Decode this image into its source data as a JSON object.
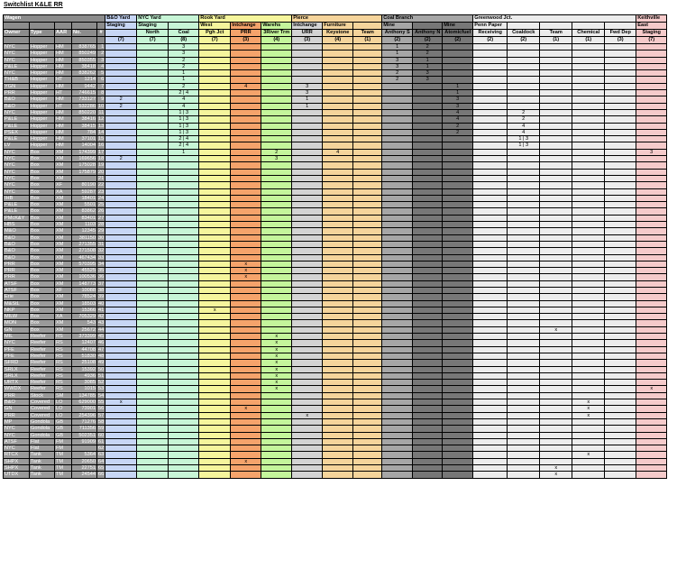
{
  "title": "Switchlist K&LE RR",
  "groups": [
    {
      "label": "Wagen",
      "span": 5,
      "cls": "hdrgrey"
    },
    {
      "label": "B&O Yard",
      "span": 1,
      "cls": "b1"
    },
    {
      "label": "NYC Yard",
      "span": 2,
      "cls": "b2"
    },
    {
      "label": "Rook Yard",
      "span": 3,
      "cls": "b3"
    },
    {
      "label": "Pierce",
      "span": 3,
      "cls": "b7"
    },
    {
      "label": "Coal Branch",
      "span": 3,
      "cls": "b8"
    },
    {
      "label": "Greenwood Jct.",
      "span": 5,
      "cls": "b10"
    },
    {
      "label": "Keithville",
      "span": 1,
      "cls": "b11"
    }
  ],
  "subheaders": [
    "",
    "",
    "",
    "",
    "",
    "Staging",
    "Staging",
    "",
    "West",
    "Intchange",
    "Warehs",
    "Intchange",
    "Furniture",
    "",
    "Mine",
    "",
    "Mine",
    "Penn Paper",
    "",
    "",
    "",
    "",
    "East"
  ],
  "headers": [
    "Owner",
    "Type",
    "AAR",
    "No.",
    "#",
    "",
    "North",
    "Coal",
    "Pgh Jct",
    "PRR",
    "3River Trm",
    "URR",
    "Keystone",
    "Team",
    "Anthony S",
    "Anthony N",
    "Atomicfuel",
    "Receiving",
    "Coaldock",
    "Team",
    "Chemical",
    "Fwd Dep",
    "Staging"
  ],
  "capacities": [
    "",
    "",
    "",
    "",
    "",
    "(7)",
    "(7)",
    "(8)",
    "(7)",
    "(3)",
    "(4)",
    "(3)",
    "(4)",
    "(1)",
    "(2)",
    "(2)",
    "(2)",
    "(2)",
    "(2)",
    "(1)",
    "(1)",
    "(3)",
    "(7)"
  ],
  "colClasses": [
    "b1",
    "b2",
    "b2",
    "b3",
    "b4",
    "b5",
    "b6",
    "b7",
    "b7",
    "b8",
    "b9",
    "b9",
    "b10",
    "b10",
    "b10",
    "b10",
    "b10",
    "b11"
  ],
  "rows": [
    [
      "NYC",
      "Hopper",
      "HM",
      "838765",
      "1",
      "",
      "",
      "3",
      "",
      "",
      "",
      "",
      "",
      "",
      "1",
      "2",
      "",
      "",
      "",
      "",
      "",
      "",
      ""
    ],
    [
      "NYC",
      "Hopper",
      "HM",
      "850249",
      "2",
      "",
      "",
      "3",
      "",
      "",
      "",
      "",
      "",
      "",
      "1",
      "2",
      "",
      "",
      "",
      "",
      "",
      "",
      ""
    ],
    [
      "NYC",
      "Hopper",
      "HM",
      "850355",
      "3",
      "",
      "",
      "2",
      "",
      "",
      "",
      "",
      "",
      "",
      "3",
      "1",
      "",
      "",
      "",
      "",
      "",
      "",
      ""
    ],
    [
      "P&LE",
      "Hopper",
      "HM",
      "38418",
      "4",
      "",
      "",
      "2",
      "",
      "",
      "",
      "",
      "",
      "",
      "3",
      "1",
      "",
      "",
      "",
      "",
      "",
      "",
      ""
    ],
    [
      "NYC",
      "Hopper",
      "HM",
      "838262",
      "5",
      "",
      "",
      "1",
      "",
      "",
      "",
      "",
      "",
      "",
      "2",
      "3",
      "",
      "",
      "",
      "",
      "",
      "",
      ""
    ],
    [
      "TH&B",
      "Hopper",
      "HT",
      "1214",
      "6",
      "",
      "",
      "1",
      "",
      "",
      "",
      "",
      "",
      "",
      "2",
      "3",
      "",
      "",
      "",
      "",
      "",
      "",
      ""
    ],
    [
      "YGN",
      "Hopper",
      "HM",
      "9442",
      "7",
      "",
      "",
      "2",
      "",
      "4",
      "",
      "3",
      "",
      "",
      "",
      "",
      "1",
      "",
      "",
      "",
      "",
      "",
      ""
    ],
    [
      "PRR",
      "Hopper",
      "HT",
      "746615",
      "8",
      "",
      "",
      "2 | 4",
      "",
      "",
      "",
      "3",
      "",
      "",
      "",
      "",
      "1",
      "",
      "",
      "",
      "",
      "",
      ""
    ],
    [
      "B&O",
      "Hopper",
      "HM",
      "733127",
      "9",
      "2",
      "",
      "4",
      "",
      "",
      "",
      "1",
      "",
      "",
      "",
      "",
      "3",
      "",
      "",
      "",
      "",
      "",
      ""
    ],
    [
      "B&O",
      "Hopper",
      "HT",
      "532286",
      "10",
      "2",
      "",
      "4",
      "",
      "",
      "",
      "1",
      "",
      "",
      "",
      "",
      "3",
      "",
      "",
      "",
      "",
      "",
      ""
    ],
    [
      "NYC",
      "Hopper",
      "HM",
      "850220",
      "11",
      "",
      "",
      "1 | 3",
      "",
      "",
      "",
      "",
      "",
      "",
      "",
      "",
      "4",
      "",
      "2",
      "",
      "",
      "",
      ""
    ],
    [
      "P&LE",
      "Hopper",
      "HM",
      "38416",
      "12",
      "",
      "",
      "1 | 3",
      "",
      "",
      "",
      "",
      "",
      "",
      "",
      "",
      "4",
      "",
      "2",
      "",
      "",
      "",
      ""
    ],
    [
      "P&LE",
      "Hopper",
      "HM",
      "38415",
      "13",
      "",
      "",
      "1 | 3",
      "",
      "",
      "",
      "",
      "",
      "",
      "",
      "",
      "2",
      "",
      "4",
      "",
      "",
      "",
      ""
    ],
    [
      "PSEX",
      "Hopper",
      "HM",
      "784",
      "14",
      "",
      "",
      "1 | 3",
      "",
      "",
      "",
      "",
      "",
      "",
      "",
      "",
      "2",
      "",
      "4",
      "",
      "",
      "",
      ""
    ],
    [
      "P&LE",
      "Hopper",
      "HM",
      "37101",
      "15",
      "",
      "",
      "2 | 4",
      "",
      "",
      "",
      "",
      "",
      "",
      "",
      "",
      "",
      "",
      "1 | 3",
      "",
      "",
      "",
      ""
    ],
    [
      "LV",
      "Hopper",
      "HM",
      "14004",
      "16",
      "",
      "",
      "2 | 4",
      "",
      "",
      "",
      "",
      "",
      "",
      "",
      "",
      "",
      "",
      "1 | 3",
      "",
      "",
      "",
      ""
    ],
    [
      "NYC",
      "Box",
      "XM",
      "174399",
      "17",
      "",
      "",
      "1",
      "",
      "",
      "2",
      "",
      "4",
      "",
      "",
      "",
      "",
      "",
      "",
      "",
      "",
      "",
      "3"
    ],
    [
      "NYC",
      "Box",
      "XM",
      "169656",
      "18",
      "2",
      "",
      "",
      "",
      "",
      "3",
      "",
      "",
      "",
      "",
      "",
      "",
      "",
      "",
      "",
      "",
      "",
      ""
    ],
    [
      "NYC",
      "Box",
      "XM",
      "175028",
      "19",
      "",
      "",
      "",
      "",
      "",
      "",
      "",
      "",
      "",
      "",
      "",
      "",
      "",
      "",
      "",
      "",
      "",
      ""
    ],
    [
      "NYC",
      "Box",
      "XM",
      "175879",
      "20",
      "",
      "",
      "",
      "",
      "",
      "",
      "",
      "",
      "",
      "",
      "",
      "",
      "",
      "",
      "",
      "",
      "",
      ""
    ],
    [
      "NYC",
      "Box",
      "XM",
      "",
      "21",
      "",
      "",
      "",
      "",
      "",
      "",
      "",
      "",
      "",
      "",
      "",
      "",
      "",
      "",
      "",
      "",
      "",
      ""
    ],
    [
      "NYC",
      "Box",
      "XF",
      "80190",
      "22",
      "",
      "",
      "",
      "",
      "",
      "",
      "",
      "",
      "",
      "",
      "",
      "",
      "",
      "",
      "",
      "",
      "",
      ""
    ],
    [
      "NYC",
      "Box",
      "XA",
      "59287",
      "23",
      "",
      "",
      "",
      "",
      "",
      "",
      "",
      "",
      "",
      "",
      "",
      "",
      "",
      "",
      "",
      "",
      "",
      ""
    ],
    [
      "IHB",
      "Box",
      "XM",
      "18401",
      "24",
      "",
      "",
      "",
      "",
      "",
      "",
      "",
      "",
      "",
      "",
      "",
      "",
      "",
      "",
      "",
      "",
      "",
      ""
    ],
    [
      "P&LE",
      "Box",
      "XM",
      "5501",
      "25",
      "",
      "",
      "",
      "",
      "",
      "",
      "",
      "",
      "",
      "",
      "",
      "",
      "",
      "",
      "",
      "",
      "",
      ""
    ],
    [
      "P&LE",
      "Box",
      "XM",
      "83862",
      "26",
      "",
      "",
      "",
      "",
      "",
      "",
      "",
      "",
      "",
      "",
      "",
      "",
      "",
      "",
      "",
      "",
      "",
      ""
    ],
    [
      "PMcK&Y",
      "Box",
      "XM",
      "83401",
      "27",
      "",
      "",
      "",
      "",
      "",
      "",
      "",
      "",
      "",
      "",
      "",
      "",
      "",
      "",
      "",
      "",
      "",
      ""
    ],
    [
      "HBS",
      "Box",
      "XM",
      "1103",
      "28",
      "",
      "",
      "",
      "",
      "",
      "",
      "",
      "",
      "",
      "",
      "",
      "",
      "",
      "",
      "",
      "",
      "",
      ""
    ],
    [
      "M&O",
      "Box",
      "XM",
      "12345",
      "29",
      "",
      "",
      "",
      "",
      "",
      "",
      "",
      "",
      "",
      "",
      "",
      "",
      "",
      "",
      "",
      "",
      "",
      ""
    ],
    [
      "B&O",
      "Box",
      "XM",
      "381150",
      "30",
      "",
      "",
      "",
      "",
      "",
      "",
      "",
      "",
      "",
      "",
      "",
      "",
      "",
      "",
      "",
      "",
      "",
      ""
    ],
    [
      "B&O",
      "Box",
      "XM",
      "271355",
      "31",
      "",
      "",
      "",
      "",
      "",
      "",
      "",
      "",
      "",
      "",
      "",
      "",
      "",
      "",
      "",
      "",
      "",
      ""
    ],
    [
      "B&O",
      "Box",
      "XM",
      "271508",
      "32",
      "",
      "",
      "",
      "",
      "",
      "",
      "",
      "",
      "",
      "",
      "",
      "",
      "",
      "",
      "",
      "",
      "",
      ""
    ],
    [
      "B&O",
      "Box",
      "XM",
      "467434",
      "33",
      "",
      "",
      "",
      "",
      "",
      "",
      "",
      "",
      "",
      "",
      "",
      "",
      "",
      "",
      "",
      "",
      "",
      ""
    ],
    [
      "PRR",
      "Box",
      "XM",
      "570395",
      "34",
      "",
      "",
      "",
      "",
      "x",
      "",
      "",
      "",
      "",
      "",
      "",
      "",
      "",
      "",
      "",
      "",
      "",
      ""
    ],
    [
      "PRR",
      "Box",
      "XM",
      "45525",
      "35",
      "",
      "",
      "",
      "",
      "x",
      "",
      "",
      "",
      "",
      "",
      "",
      "",
      "",
      "",
      "",
      "",
      "",
      ""
    ],
    [
      "PRR",
      "Box",
      "XM",
      "100536",
      "36",
      "",
      "",
      "",
      "",
      "x",
      "",
      "",
      "",
      "",
      "",
      "",
      "",
      "",
      "",
      "",
      "",
      "",
      ""
    ],
    [
      "ATSF",
      "Box",
      "XM",
      "148773",
      "37",
      "",
      "",
      "",
      "",
      "",
      "",
      "",
      "",
      "",
      "",
      "",
      "",
      "",
      "",
      "",
      "",
      "",
      ""
    ],
    [
      "ATSF",
      "Box",
      "XF",
      "10088",
      "38",
      "",
      "",
      "",
      "",
      "",
      "",
      "",
      "",
      "",
      "",
      "",
      "",
      "",
      "",
      "",
      "",
      "",
      ""
    ],
    [
      "Erie",
      "Box",
      "XM",
      "78524",
      "39",
      "",
      "",
      "",
      "",
      "",
      "",
      "",
      "",
      "",
      "",
      "",
      "",
      "",
      "",
      "",
      "",
      "",
      ""
    ],
    [
      "M&StL",
      "Box",
      "XM",
      "18503",
      "40",
      "",
      "",
      "",
      "",
      "",
      "",
      "",
      "",
      "",
      "",
      "",
      "",
      "",
      "",
      "",
      "",
      "",
      ""
    ],
    [
      "NKP",
      "Box",
      "XM",
      "15366",
      "41",
      "",
      "",
      "",
      "x",
      "",
      "",
      "",
      "",
      "",
      "",
      "",
      "",
      "",
      "",
      "",
      "",
      "",
      ""
    ],
    [
      "MILW",
      "Box",
      "XA",
      "705329",
      "42",
      "",
      "",
      "",
      "",
      "",
      "",
      "",
      "",
      "",
      "",
      "",
      "",
      "",
      "",
      "",
      "",
      "",
      ""
    ],
    [
      "MON",
      "Box",
      "XM",
      "543",
      "43",
      "",
      "",
      "",
      "",
      "",
      "",
      "",
      "",
      "",
      "",
      "",
      "",
      "",
      "",
      "",
      "",
      "",
      ""
    ],
    [
      "GN",
      "Box",
      "XM",
      "25672",
      "44",
      "",
      "",
      "",
      "",
      "",
      "",
      "",
      "",
      "",
      "",
      "",
      "",
      "",
      "",
      "x",
      "",
      "",
      ""
    ],
    [
      "MIL",
      "Reefer",
      "RS",
      "373399",
      "45",
      "",
      "",
      "",
      "",
      "",
      "x",
      "",
      "",
      "",
      "",
      "",
      "",
      "",
      "",
      "",
      "",
      "",
      ""
    ],
    [
      "NYC",
      "Reefer",
      "RS",
      "12407",
      "46",
      "",
      "",
      "",
      "",
      "",
      "x",
      "",
      "",
      "",
      "",
      "",
      "",
      "",
      "",
      "",
      "",
      "",
      ""
    ],
    [
      "PFE",
      "Reefer",
      "RS",
      "44708",
      "47",
      "",
      "",
      "",
      "",
      "",
      "x",
      "",
      "",
      "",
      "",
      "",
      "",
      "",
      "",
      "",
      "",
      "",
      ""
    ],
    [
      "PFE",
      "Reefer",
      "RS",
      "51830",
      "48",
      "",
      "",
      "",
      "",
      "",
      "x",
      "",
      "",
      "",
      "",
      "",
      "",
      "",
      "",
      "",
      "",
      "",
      ""
    ],
    [
      "SFRD",
      "Reefer",
      "RS",
      "25108",
      "49",
      "",
      "",
      "",
      "",
      "",
      "x",
      "",
      "",
      "",
      "",
      "",
      "",
      "",
      "",
      "",
      "",
      "",
      ""
    ],
    [
      "SRLX",
      "Reefer",
      "RS",
      "15392",
      "50",
      "",
      "",
      "",
      "",
      "",
      "x",
      "",
      "",
      "",
      "",
      "",
      "",
      "",
      "",
      "",
      "",
      "",
      ""
    ],
    [
      "SRLX",
      "Reefer",
      "RS",
      "4936",
      "51",
      "",
      "",
      "",
      "",
      "",
      "x",
      "",
      "",
      "",
      "",
      "",
      "",
      "",
      "",
      "",
      "",
      "",
      ""
    ],
    [
      "URTX",
      "Reefer",
      "RS",
      "3085",
      "52",
      "",
      "",
      "",
      "",
      "",
      "x",
      "",
      "",
      "",
      "",
      "",
      "",
      "",
      "",
      "",
      "",
      "",
      ""
    ],
    [
      "WWDX",
      "Reefer",
      "RS",
      "1015",
      "53",
      "",
      "",
      "",
      "",
      "",
      "x",
      "",
      "",
      "",
      "",
      "",
      "",
      "",
      "",
      "",
      "",
      "",
      "x"
    ],
    [
      "PRR",
      "Stock",
      "SM",
      "134785",
      "54",
      "",
      "",
      "",
      "",
      "",
      "",
      "",
      "",
      "",
      "",
      "",
      "",
      "",
      "",
      "",
      "",
      "",
      ""
    ],
    [
      "B&O",
      "Covered",
      "LO",
      "629000",
      "55",
      "x",
      "",
      "",
      "",
      "",
      "",
      "",
      "",
      "",
      "",
      "",
      "",
      "",
      "",
      "",
      "x",
      "",
      ""
    ],
    [
      "GN",
      "Covered",
      "LO",
      "73901",
      "56",
      "",
      "",
      "",
      "",
      "x",
      "",
      "",
      "",
      "",
      "",
      "",
      "",
      "",
      "",
      "",
      "x",
      "",
      ""
    ],
    [
      "PRR",
      "Covered",
      "LO",
      "254396",
      "57",
      "",
      "",
      "",
      "",
      "",
      "",
      "x",
      "",
      "",
      "",
      "",
      "",
      "",
      "",
      "",
      "x",
      "",
      ""
    ],
    [
      "MP",
      "Gondola",
      "GB",
      "71276",
      "58",
      "",
      "",
      "",
      "",
      "",
      "",
      "",
      "",
      "",
      "",
      "",
      "",
      "",
      "",
      "",
      "",
      "",
      ""
    ],
    [
      "NYC",
      "Gondola",
      "GB",
      "711356",
      "59",
      "",
      "",
      "",
      "",
      "",
      "",
      "",
      "",
      "",
      "",
      "",
      "",
      "",
      "",
      "",
      "",
      "",
      ""
    ],
    [
      "NYC",
      "Gondola",
      "GB",
      "502351",
      "60",
      "",
      "",
      "",
      "",
      "",
      "",
      "",
      "",
      "",
      "",
      "",
      "",
      "",
      "",
      "",
      "",
      "",
      ""
    ],
    [
      "ATSF",
      "Flat",
      "FM",
      "91909",
      "61",
      "",
      "",
      "",
      "",
      "",
      "",
      "",
      "",
      "",
      "",
      "",
      "",
      "",
      "",
      "",
      "",
      "",
      ""
    ],
    [
      "NYC",
      "Flat",
      "FM",
      "",
      "62",
      "",
      "",
      "",
      "",
      "",
      "",
      "",
      "",
      "",
      "",
      "",
      "",
      "",
      "",
      "",
      "",
      "",
      ""
    ],
    [
      "RTCX",
      "Tank",
      "TM",
      "5364",
      "63",
      "",
      "",
      "",
      "",
      "",
      "",
      "",
      "",
      "",
      "",
      "",
      "",
      "",
      "",
      "",
      "x",
      "",
      ""
    ],
    [
      "SHPX",
      "Tank",
      "TM",
      "20650",
      "64",
      "",
      "",
      "",
      "",
      "x",
      "",
      "",
      "",
      "",
      "",
      "",
      "",
      "",
      "",
      "",
      "",
      "",
      ""
    ],
    [
      "SHPX",
      "Tank",
      "TM",
      "22751",
      "65",
      "",
      "",
      "",
      "",
      "",
      "",
      "",
      "",
      "",
      "",
      "",
      "",
      "",
      "",
      "x",
      "",
      "",
      ""
    ],
    [
      "UTDX",
      "Tank",
      "TM",
      "24544",
      "66",
      "",
      "",
      "",
      "",
      "",
      "",
      "",
      "",
      "",
      "",
      "",
      "",
      "",
      "",
      "x",
      "",
      "",
      ""
    ]
  ]
}
